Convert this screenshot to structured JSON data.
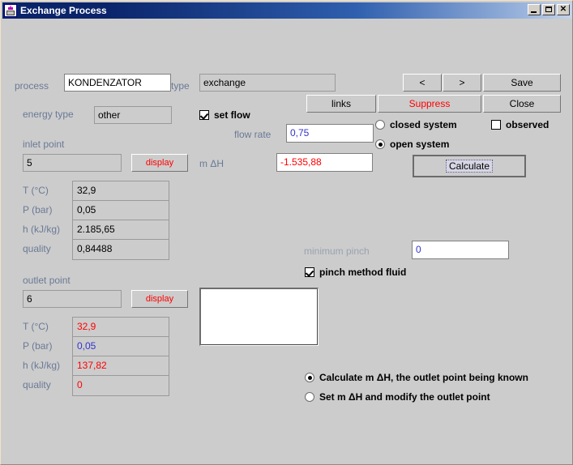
{
  "window": {
    "title": "Exchange Process",
    "icon": "app-icon",
    "buttons": {
      "minimize": "_",
      "maximize": "□",
      "close": "×"
    }
  },
  "colors": {
    "label": "#6a7a96",
    "value_red": "#ff0000",
    "value_blue": "#3333cc",
    "background": "#cccccc",
    "titlebar": "#0a246a"
  },
  "form": {
    "process_label": "process",
    "process_value": "KONDENZATOR",
    "type_label": "type",
    "type_value": "exchange",
    "energy_type_label": "energy type",
    "energy_type_value": "other",
    "links_button": "links",
    "suppress_button": "Suppress",
    "prev_button": "<",
    "next_button": ">",
    "save_button": "Save",
    "close_button": "Close",
    "set_flow_label": "set flow",
    "set_flow_checked": true,
    "flow_rate_label": "flow rate",
    "flow_rate_value": "0,75",
    "m_dh_label": "m ΔH",
    "m_dh_value": "-1.535,88",
    "closed_system_label": "closed system",
    "open_system_label": "open system",
    "system_selected": "open",
    "observed_label": "observed",
    "observed_checked": false,
    "calculate_button": "Calculate",
    "minimum_pinch_label": "minimum pinch",
    "minimum_pinch_value": "0",
    "pinch_method_label": "pinch method fluid",
    "pinch_method_checked": true
  },
  "inlet": {
    "section_label": "inlet point",
    "point_value": "5",
    "display_button": "display",
    "rows": [
      {
        "label": "T (°C)",
        "value": "32,9"
      },
      {
        "label": "P (bar)",
        "value": "0,05"
      },
      {
        "label": "h (kJ/kg)",
        "value": "2.185,65"
      },
      {
        "label": "quality",
        "value": "0,84488"
      }
    ]
  },
  "outlet": {
    "section_label": "outlet point",
    "point_value": "6",
    "display_button": "display",
    "rows": [
      {
        "label": "T (°C)",
        "value": "32,9",
        "color": "red"
      },
      {
        "label": "P (bar)",
        "value": "0,05",
        "color": "blue"
      },
      {
        "label": "h (kJ/kg)",
        "value": "137,82",
        "color": "red"
      },
      {
        "label": "quality",
        "value": "0",
        "color": "red"
      }
    ]
  },
  "mode_options": {
    "calculate_option": "Calculate m ΔH, the outlet point being known",
    "set_option": "Set m ΔH and modify the outlet point",
    "selected": "calculate"
  }
}
